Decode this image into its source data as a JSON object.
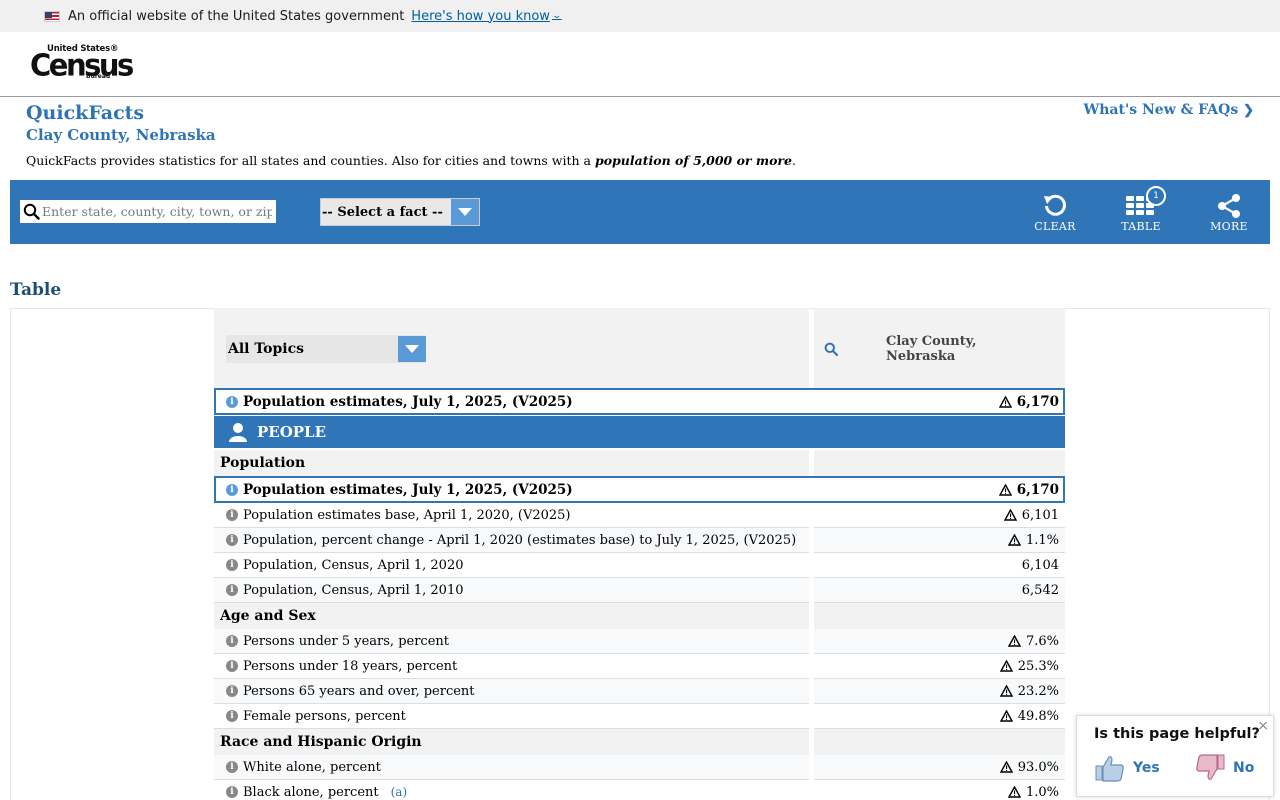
{
  "gov_banner": {
    "text": "An official website of the United States government",
    "link": "Here's how you know"
  },
  "logo": {
    "top": "United States®",
    "main": "Census",
    "bottom": "Bureau"
  },
  "page": {
    "title": "QuickFacts",
    "geography": "Clay County, Nebraska",
    "description_prefix": "QuickFacts provides statistics for all states and counties. Also for cities and towns with a",
    "description_emphasis": "population of 5,000 or more",
    "description_suffix": ".",
    "whats_new": "What's New & FAQs"
  },
  "toolbar": {
    "search_placeholder": "Enter state, county, city, town, or zip code",
    "fact_select": "-- Select a fact --",
    "clear": "CLEAR",
    "table": "TABLE",
    "table_badge": "1",
    "more": "MORE"
  },
  "table": {
    "heading": "Table",
    "topics_select": "All Topics",
    "column_header_line1": "Clay County,",
    "column_header_line2": "Nebraska",
    "top_row": {
      "label": "Population estimates, July 1, 2025, (V2025)",
      "value": "6,170"
    },
    "people_label": "PEOPLE",
    "sections": [
      {
        "title": "Population",
        "rows": [
          {
            "label": "Population estimates, July 1, 2025, (V2025)",
            "value": "6,170"
          },
          {
            "label": "Population estimates base, April 1, 2020, (V2025)",
            "value": "6,101"
          },
          {
            "label": "Population, percent change - April 1, 2020 (estimates base) to July 1, 2025, (V2025)",
            "value": "1.1%"
          },
          {
            "label": "Population, Census, April 1, 2020",
            "value": "6,104"
          },
          {
            "label": "Population, Census, April 1, 2010",
            "value": "6,542"
          }
        ]
      },
      {
        "title": "Age and Sex",
        "rows": [
          {
            "label": "Persons under 5 years, percent",
            "value": "7.6%"
          },
          {
            "label": "Persons under 18 years, percent",
            "value": "25.3%"
          },
          {
            "label": "Persons 65 years and over, percent",
            "value": "23.2%"
          },
          {
            "label": "Female persons, percent",
            "value": "49.8%"
          }
        ]
      },
      {
        "title": "Race and Hispanic Origin",
        "rows": [
          {
            "label": "White alone, percent",
            "value": "93.0%"
          },
          {
            "label": "Black alone, percent",
            "note": "(a)",
            "value": "1.0%"
          }
        ]
      }
    ]
  },
  "feedback": {
    "question": "Is this page helpful?",
    "yes": "Yes",
    "no": "No",
    "close": "×"
  },
  "colors": {
    "brand_blue": "#2f75b8",
    "link_blue": "#2e74b5",
    "select_arrow": "#5a9ad6"
  }
}
